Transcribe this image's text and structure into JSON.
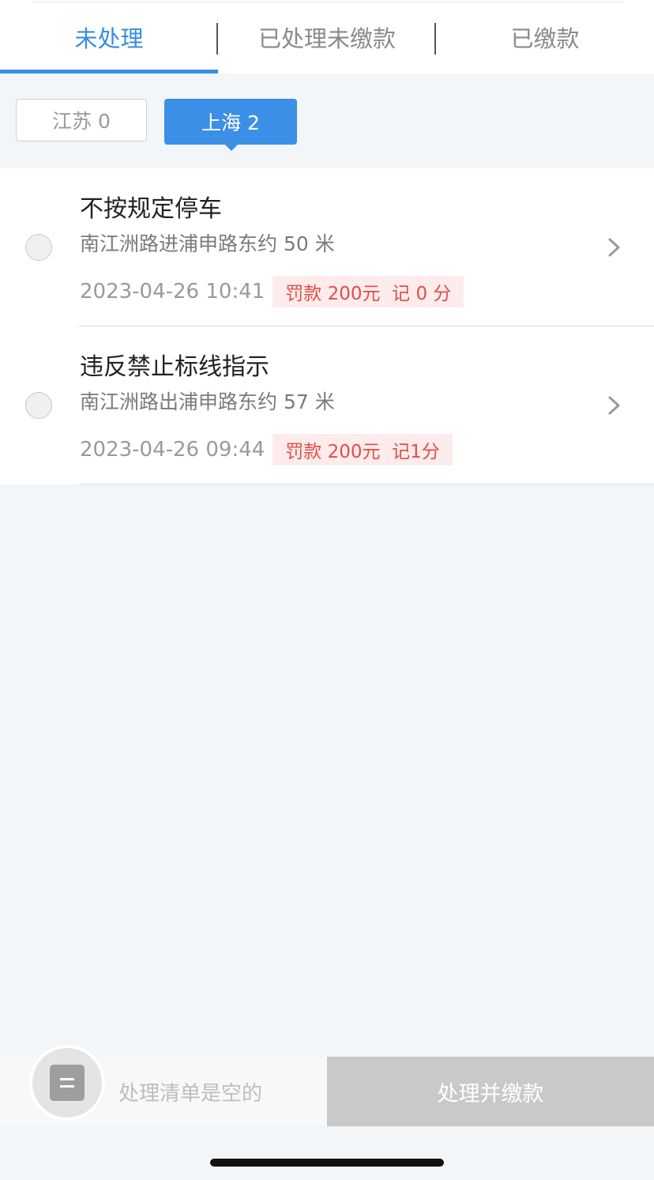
{
  "tabs": [
    {
      "label": "未处理",
      "active": true
    },
    {
      "label": "已处理未缴款",
      "active": false
    },
    {
      "label": "已缴款",
      "active": false
    }
  ],
  "provinces": [
    {
      "label": "江苏 0",
      "active": false
    },
    {
      "label": "上海 2",
      "active": true
    }
  ],
  "violations": [
    {
      "title": "不按规定停车",
      "address": "南江洲路进浦申路东约 50 米",
      "time": "2023-04-26 10:41",
      "penalty": "罚款 200元  记 0 分"
    },
    {
      "title": "违反禁止标线指示",
      "address": "南江洲路出浦申路东约 57 米",
      "time": "2023-04-26 09:44",
      "penalty": "罚款 200元  记1分"
    }
  ],
  "bottom": {
    "empty_text": "处理清单是空的",
    "pay_button": "处理并缴款"
  },
  "colors": {
    "accent": "#3b8fe6",
    "penalty_text": "#e04e48",
    "penalty_bg": "#fdeceb",
    "disabled_button": "#c9c9c9"
  }
}
